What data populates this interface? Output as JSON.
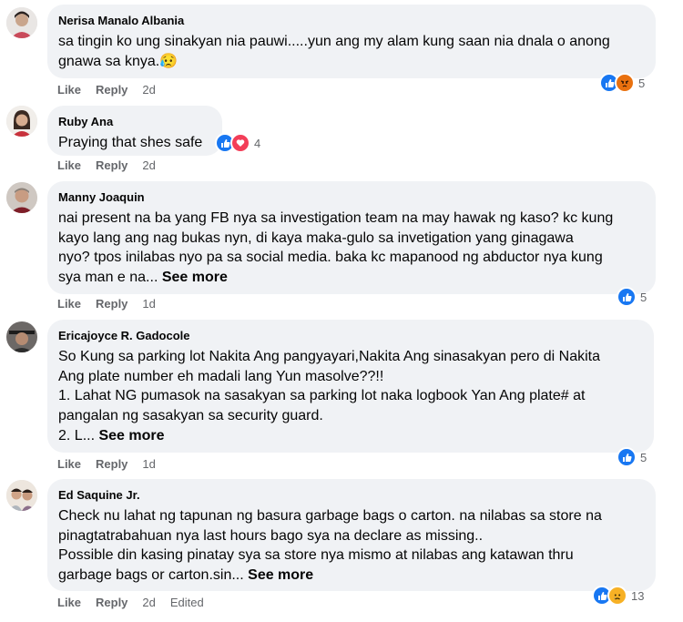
{
  "labels": {
    "like": "Like",
    "reply": "Reply",
    "see_more": "See more"
  },
  "comments": [
    {
      "author": "Nerisa Manalo Albania",
      "lines": [
        "sa tingin ko ung sinakyan nia pauwi.....yun ang my alam kung saan nia dnala o anong",
        "gnawa sa knya.😥"
      ],
      "time": "2d",
      "edited": "",
      "reaction_icons": [
        "like-icon",
        "angry-icon"
      ],
      "reaction_count": "5"
    },
    {
      "author": "Ruby Ana",
      "lines": [
        "Praying that shes safe"
      ],
      "time": "2d",
      "edited": "",
      "reaction_icons": [
        "like-icon",
        "love-icon"
      ],
      "reaction_count": "4"
    },
    {
      "author": "Manny Joaquin",
      "lines": [
        "nai present na ba yang FB nya sa investigation team na may hawak ng kaso? kc kung",
        "kayo lang ang nag bukas nyn, di kaya maka-gulo sa invetigation yang ginagawa",
        "nyo? tpos inilabas nyo pa sa social media. baka kc mapanood ng abductor nya kung",
        "sya man e na..."
      ],
      "time": "1d",
      "edited": "",
      "reaction_icons": [
        "like-icon"
      ],
      "reaction_count": "5"
    },
    {
      "author": "Ericajoyce R. Gadocole",
      "lines": [
        "So Kung sa parking lot Nakita Ang pangyayari,Nakita Ang sinasakyan pero di Nakita",
        "Ang plate number eh madali lang Yun masolve??!!",
        "1. Lahat NG pumasok na sasakyan sa parking lot naka logbook Yan Ang plate# at",
        "pangalan ng sasakyan sa security guard.",
        "2. L..."
      ],
      "time": "1d",
      "edited": "",
      "reaction_icons": [
        "like-icon"
      ],
      "reaction_count": "5"
    },
    {
      "author": "Ed Saquine Jr.",
      "lines": [
        "Check nu lahat ng tapunan ng basura garbage bags o carton. na nilabas sa store na",
        "pinagtatrabahuan nya last hours bago sya na declare as missing..",
        "Possible din kasing pinatay sya sa store nya mismo at nilabas ang katawan thru",
        "garbage bags or carton.sin..."
      ],
      "time": "2d",
      "edited": "Edited",
      "reaction_icons": [
        "like-icon",
        "sad-icon"
      ],
      "reaction_count": "13"
    }
  ]
}
